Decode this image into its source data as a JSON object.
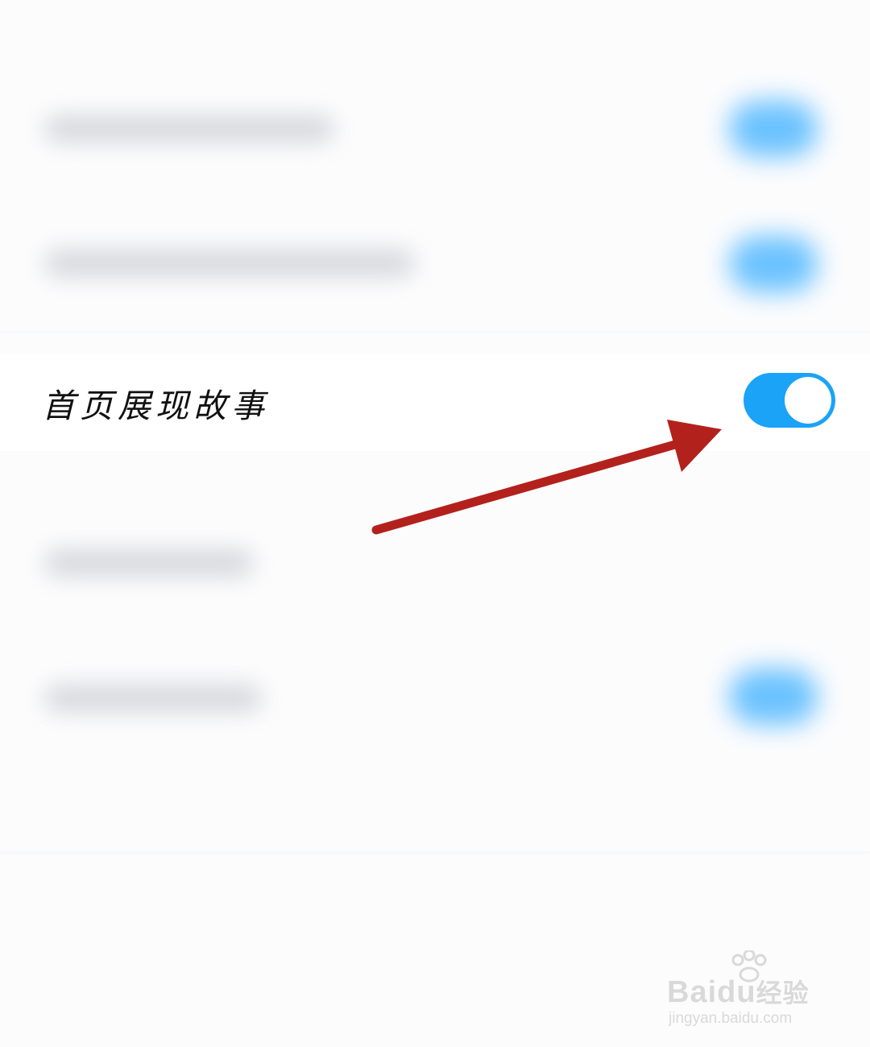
{
  "settings": {
    "focused_item": {
      "label": "首页展现故事",
      "toggle_on": true
    }
  },
  "watermark": {
    "brand_latin_1": "Bai",
    "brand_latin_2": "du",
    "brand_cn": "经验",
    "url": "jingyan.baidu.com"
  },
  "colors": {
    "toggle_on": "#1aa3f7",
    "arrow": "#b3211c",
    "background": "#fcfcfd"
  },
  "icons": {
    "arrow": "red-annotation-arrow-icon",
    "paw": "baidu-paw-icon"
  }
}
